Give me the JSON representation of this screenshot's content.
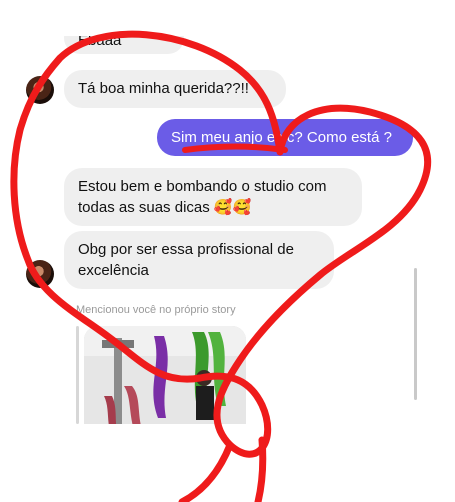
{
  "messages": [
    {
      "id": "m1",
      "side": "in",
      "text": "Ebaaa"
    },
    {
      "id": "m2",
      "side": "in",
      "text": "Tá boa minha querida??!!"
    },
    {
      "id": "m3",
      "side": "out",
      "text": "Sim meu anjo e vc? Como está ?"
    },
    {
      "id": "m4",
      "side": "in",
      "text": "Estou bem e bombando o studio com todas as suas dicas 🥰🥰"
    },
    {
      "id": "m5",
      "side": "in",
      "text": "Obg por ser essa profissional  de excelência"
    }
  ],
  "story_mention": {
    "caption": "Mencionou você no próprio story"
  },
  "colors": {
    "outgoing_bubble": "#6b5ce7",
    "incoming_bubble": "#efefef",
    "scribble": "#ef1b1b"
  },
  "icons": [
    "avatar"
  ]
}
